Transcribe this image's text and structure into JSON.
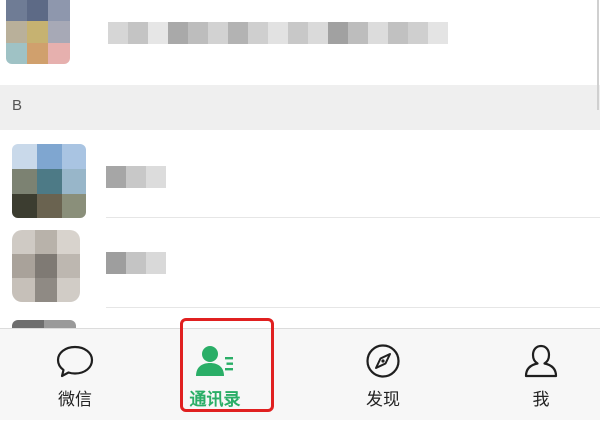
{
  "section": {
    "letter": "B"
  },
  "tabs": [
    {
      "key": "chats",
      "label": "微信",
      "icon": "chat-bubble-icon",
      "active": false
    },
    {
      "key": "contacts",
      "label": "通讯录",
      "icon": "contacts-icon",
      "active": true
    },
    {
      "key": "discover",
      "label": "发现",
      "icon": "compass-icon",
      "active": false
    },
    {
      "key": "me",
      "label": "我",
      "icon": "person-icon",
      "active": false
    }
  ],
  "colors": {
    "accent_green": "#2aae67",
    "highlight_red": "#e02020",
    "tabbar_bg": "#f7f7f7",
    "section_bg": "#efefef"
  }
}
